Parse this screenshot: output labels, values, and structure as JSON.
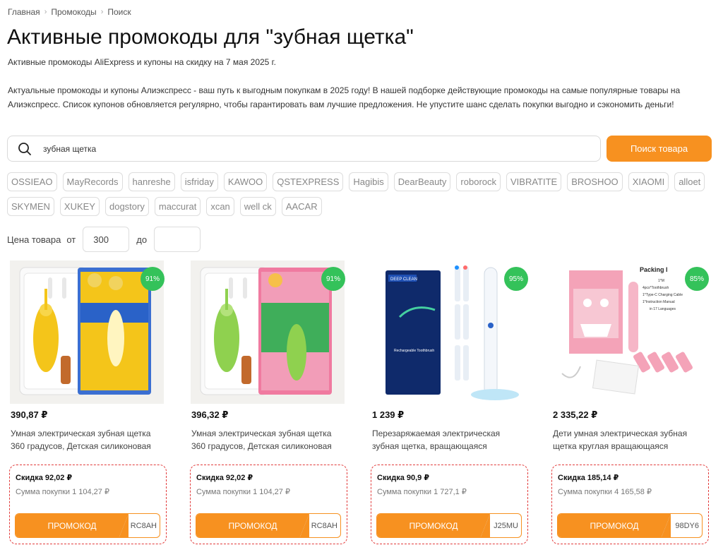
{
  "breadcrumb": [
    "Главная",
    "Промокоды",
    "Поиск"
  ],
  "title": "Активные промокоды для \"зубная щетка\"",
  "subtitle": "Активные промокоды AliExpress и купоны на скидку на 7 мая 2025 г.",
  "intro": "Актуальные промокоды и купоны Алиэкспресс - ваш путь к выгодным покупкам в 2025 году! В нашей подборке действующие промокоды на самые популярные товары на Алиэкспресс. Список купонов обновляется регулярно, чтобы гарантировать вам лучшие предложения. Не упустите шанс сделать покупки выгодно и сэкономить деньги!",
  "search": {
    "value": "зубная щетка",
    "button": "Поиск товара",
    "icon": "search-icon"
  },
  "tags": [
    "OSSIEAO",
    "MayRecords",
    "hanreshe",
    "isfriday",
    "KAWOO",
    "QSTEXPRESS",
    "Hagibis",
    "DearBeauty",
    "roborock",
    "VIBRATITE",
    "BROSHOO",
    "XIAOMI",
    "alloet",
    "SKYMEN",
    "XUKEY",
    "dogstory",
    "maccurat",
    "xcan",
    "well ck",
    "AACAR"
  ],
  "price_filter": {
    "label": "Цена товара",
    "from": "от",
    "to": "до",
    "from_value": "300",
    "to_value": ""
  },
  "accent_color": "#f79120",
  "badge_color": "#34c25a",
  "products": [
    {
      "badge": "91%",
      "price": "390,87 ₽",
      "title_line1": "Умная электрическая зубная щетка",
      "title_line2": "360 градусов, Детская силиконовая",
      "discount": "Скидка 92,02 ₽",
      "sum": "Сумма покупки 1 104,27 ₽",
      "promo_label": "ПРОМОКОД",
      "code": "RC8AH",
      "image": "yellow-kids-toothbrush"
    },
    {
      "badge": "91%",
      "price": "396,32 ₽",
      "title_line1": "Умная электрическая зубная щетка",
      "title_line2": "360 градусов, Детская силиконовая",
      "discount": "Скидка 92,02 ₽",
      "sum": "Сумма покупки 1 104,27 ₽",
      "promo_label": "ПРОМОКОД",
      "code": "RC8AH",
      "image": "green-kids-toothbrush"
    },
    {
      "badge": "95%",
      "price": "1 239 ₽",
      "title_line1": "Перезаряжаемая электрическая",
      "title_line2": "зубная щетка, вращающаяся",
      "discount": "Скидка 90,9 ₽",
      "sum": "Сумма покупки 1 727,1 ₽",
      "promo_label": "ПРОМОКОД",
      "code": "J25MU",
      "image": "rechargeable-toothbrush-set",
      "image_texts": {
        "box_top": "DEEP CLEAN",
        "box_main": "Rechargeable Toothbrush"
      }
    },
    {
      "badge": "85%",
      "price": "2 335,22 ₽",
      "title_line1": "Дети умная электрическая зубная",
      "title_line2": "щетка круглая вращающаяся",
      "discount": "Скидка 185,14 ₽",
      "sum": "Сумма покупки 4 165,58 ₽",
      "promo_label": "ПРОМОКОД",
      "code": "98DY6",
      "image": "pink-kids-toothbrush-kit",
      "image_texts": {
        "packing_title": "Packing l",
        "packing_line1": "1*M",
        "packing_line2": "4pcs*Toothbrush",
        "packing_line3": "1*Type-C Charging Cable",
        "packing_line4": "1*Instruction Manual",
        "packing_line5": "in 17 Languages"
      }
    }
  ]
}
